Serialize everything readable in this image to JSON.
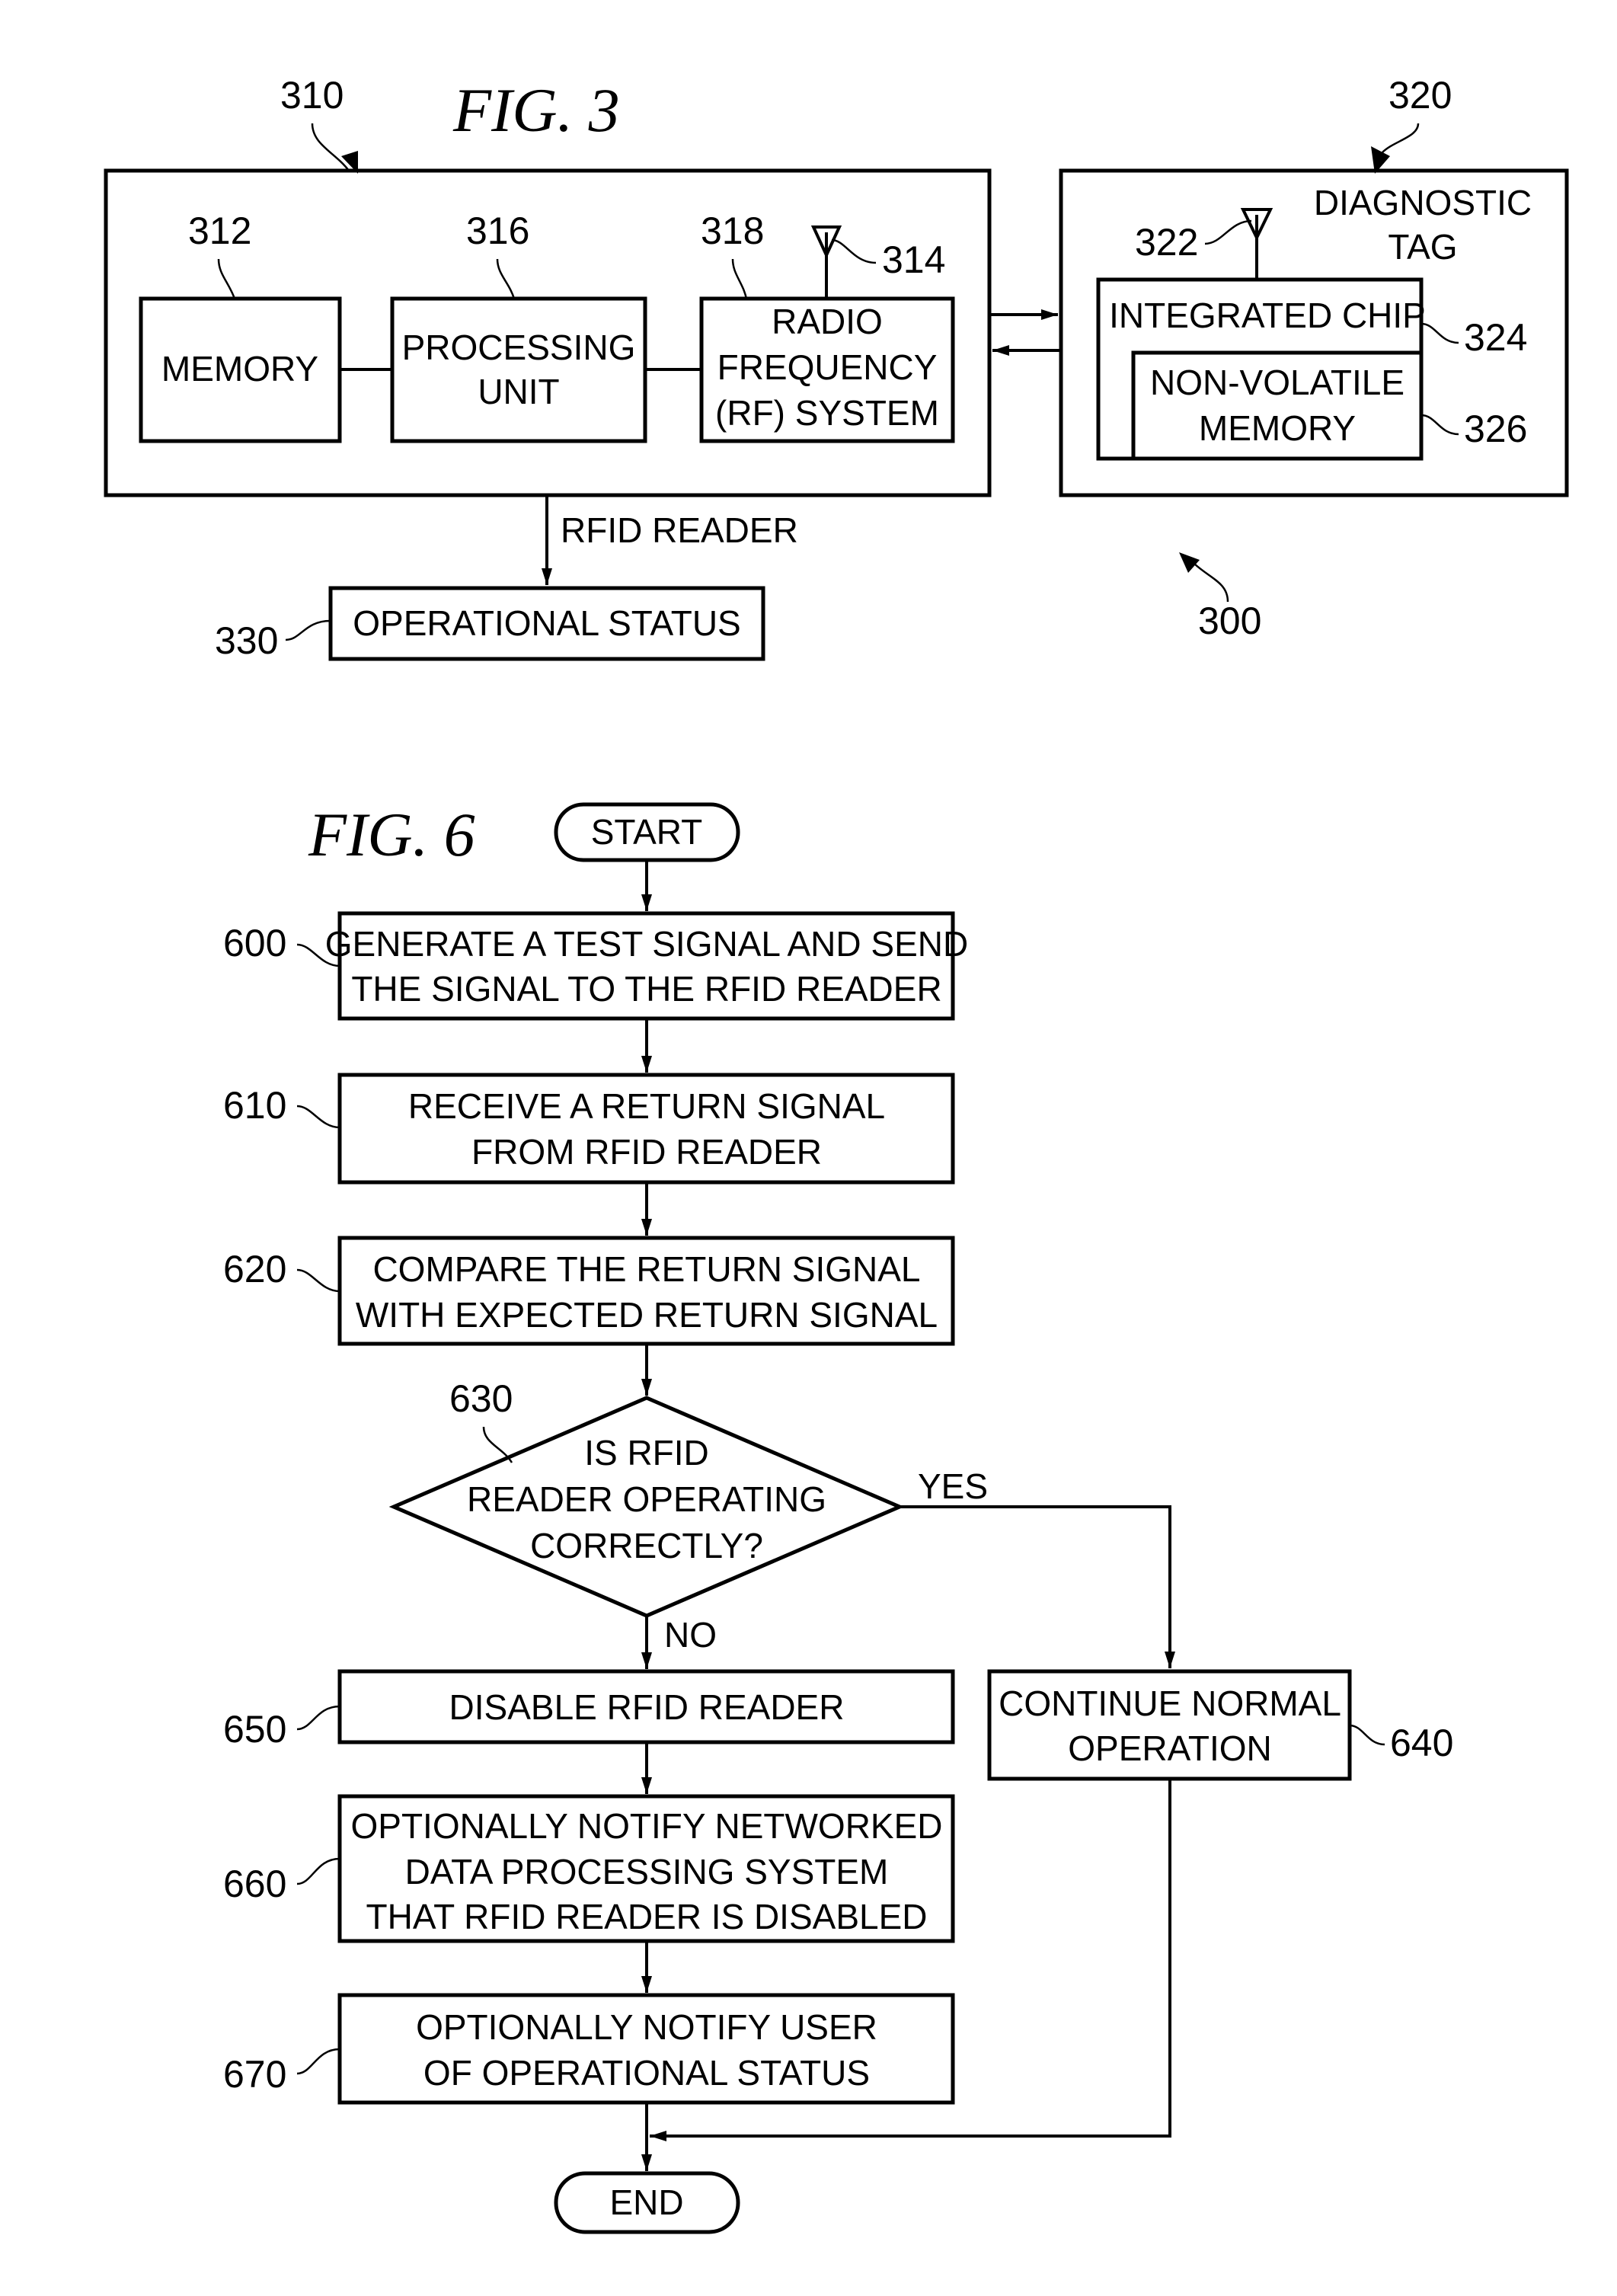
{
  "fig3": {
    "title": "FIG. 3",
    "system_ref": "300",
    "reader": {
      "ref": "310",
      "label": "RFID READER",
      "memory": {
        "ref": "312",
        "label": "MEMORY"
      },
      "processing": {
        "ref": "316",
        "lines": [
          "PROCESSING",
          "UNIT"
        ]
      },
      "rf": {
        "ref": "318",
        "lines": [
          "RADIO",
          "FREQUENCY",
          "(RF) SYSTEM"
        ]
      },
      "antenna_ref": "314"
    },
    "tag": {
      "ref": "320",
      "lines": [
        "DIAGNOSTIC",
        "TAG"
      ],
      "antenna_ref": "322",
      "chip": {
        "ref": "324",
        "label": "INTEGRATED CHIP"
      },
      "nvm": {
        "ref": "326",
        "lines": [
          "NON-VOLATILE",
          "MEMORY"
        ]
      }
    },
    "status": {
      "ref": "330",
      "label": "OPERATIONAL STATUS"
    }
  },
  "fig6": {
    "title": "FIG. 6",
    "start": "START",
    "end": "END",
    "steps": {
      "s600": {
        "ref": "600",
        "lines": [
          "GENERATE A TEST SIGNAL AND SEND",
          "THE SIGNAL TO THE RFID READER"
        ]
      },
      "s610": {
        "ref": "610",
        "lines": [
          "RECEIVE A RETURN SIGNAL",
          "FROM RFID READER"
        ]
      },
      "s620": {
        "ref": "620",
        "lines": [
          "COMPARE THE RETURN SIGNAL",
          "WITH EXPECTED RETURN SIGNAL"
        ]
      },
      "s630": {
        "ref": "630",
        "lines": [
          "IS RFID",
          "READER OPERATING",
          "CORRECTLY?"
        ],
        "yes": "YES",
        "no": "NO"
      },
      "s640": {
        "ref": "640",
        "lines": [
          "CONTINUE NORMAL",
          "OPERATION"
        ]
      },
      "s650": {
        "ref": "650",
        "lines": [
          "DISABLE RFID READER"
        ]
      },
      "s660": {
        "ref": "660",
        "lines": [
          "OPTIONALLY NOTIFY NETWORKED",
          "DATA PROCESSING SYSTEM",
          "THAT RFID READER IS DISABLED"
        ]
      },
      "s670": {
        "ref": "670",
        "lines": [
          "OPTIONALLY NOTIFY USER",
          "OF OPERATIONAL STATUS"
        ]
      }
    }
  }
}
